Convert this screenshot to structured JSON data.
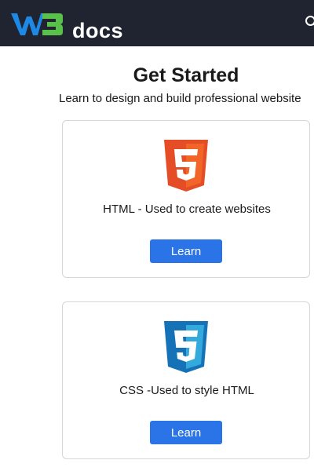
{
  "header": {
    "logo_text": "docs",
    "logo_mark": "W3",
    "search_icon": "search-icon"
  },
  "main": {
    "title": "Get Started",
    "subtitle": "Learn to design and build professional website"
  },
  "cards": [
    {
      "icon": "html5-icon",
      "description": "HTML - Used to create websites",
      "button_label": "Learn"
    },
    {
      "icon": "css3-icon",
      "description": "CSS -Used to style HTML",
      "button_label": "Learn"
    }
  ],
  "colors": {
    "header_bg": "#1f2430",
    "logo_blue": "#1e88e5",
    "logo_green": "#59c04a",
    "html_orange": "#e44d26",
    "css_blue": "#1572b6",
    "button_blue": "#2b74e8"
  }
}
